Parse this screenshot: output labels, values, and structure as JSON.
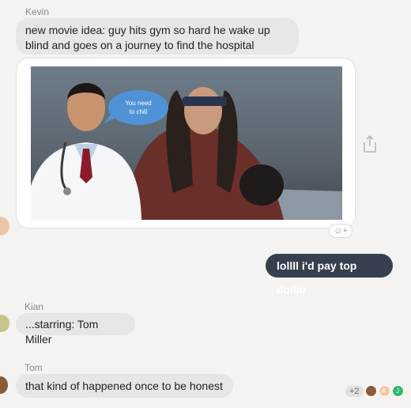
{
  "messages": [
    {
      "sender": "Kevin",
      "text": "new movie idea: guy hits gym so hard he wake up blind and goes on a journey to find the hospital"
    },
    {
      "sender": "",
      "text": "lollll i'd pay top dollar",
      "outgoing": true
    },
    {
      "sender": "Kian",
      "text": "...starring: Tom Miller"
    },
    {
      "sender": "Tom",
      "text": "that kind of happened once to be honest"
    }
  ],
  "meme": {
    "speech_text": "You need to chill",
    "description": "photo collage meme"
  },
  "reactions": {
    "add_reaction_icon": "emoji-plus-icon"
  },
  "seen_by": {
    "extra_count": "+2",
    "letters": [
      "K",
      "J"
    ]
  },
  "colors": {
    "outgoing_bg": "#37404e",
    "incoming_bg": "#e8e6e4",
    "kian_avatar": "#c8c38a",
    "tom_avatar": "#8a5a3c",
    "seen_k": "#f2c9a0",
    "seen_j": "#2eb86b"
  }
}
